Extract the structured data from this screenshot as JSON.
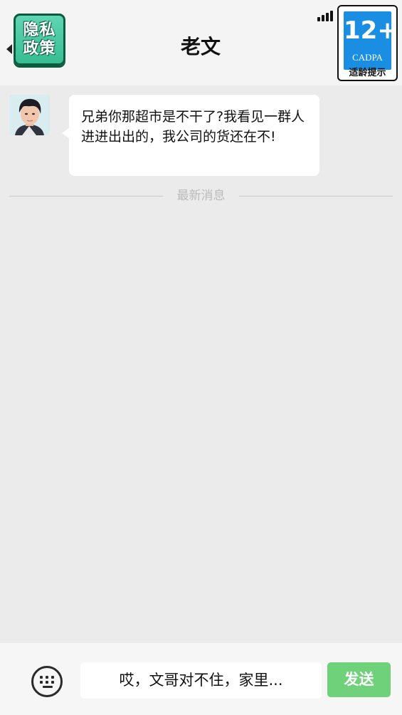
{
  "header": {
    "title": "老文",
    "privacy_button_label": "隐私政策",
    "age_rating": {
      "number": "12+",
      "org": "CADPA",
      "label": "适龄提示"
    }
  },
  "messages": [
    {
      "sender": "老文",
      "text": "兄弟你那超市是不干了?我看见一群人进进出出的，我公司的货还在不!"
    }
  ],
  "divider_label": "最新消息",
  "composer": {
    "reply_text": "哎，文哥对不住，家里...",
    "send_label": "发送"
  },
  "colors": {
    "background": "#ebebeb",
    "header": "#f4f4f4",
    "privacy_button": "#3fc59b",
    "age_badge_blue": "#1a8ee3",
    "send_button": "#6fd17a"
  },
  "icons": [
    "back-chevron-icon",
    "signal-icon",
    "keyboard-icon"
  ]
}
